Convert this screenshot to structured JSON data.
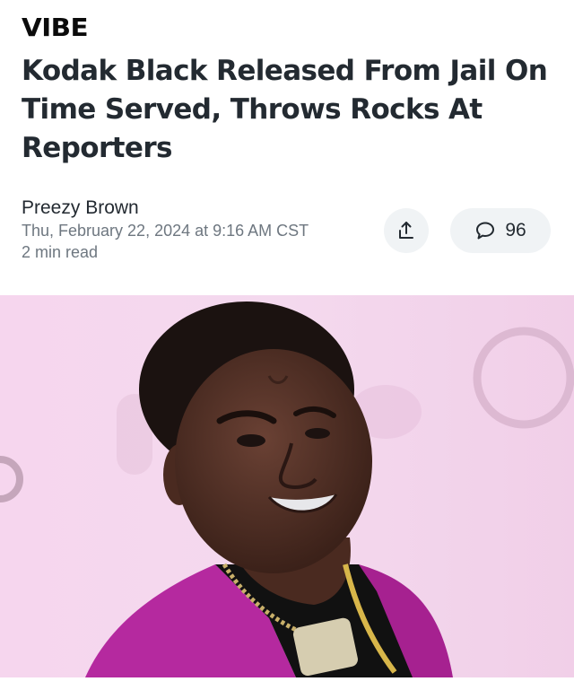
{
  "brand": {
    "logo_text": "VIBE"
  },
  "article": {
    "headline": "Kodak Black Released From Jail On Time Served, Throws Rocks At Reporters",
    "author": "Preezy Brown",
    "date": "Thu, February 22, 2024 at 9:16 AM CST",
    "read_time": "2 min read"
  },
  "actions": {
    "share_icon": "share-icon",
    "comment_icon": "comment-bubble-icon",
    "comment_count": "96"
  },
  "hero_image": {
    "subject": "photo-portrait"
  },
  "colors": {
    "text": "#232a31",
    "meta": "#6e7780",
    "button_bg": "#f0f3f5",
    "hero_bg": "#f3d3ec",
    "jacket": "#b5299f"
  }
}
